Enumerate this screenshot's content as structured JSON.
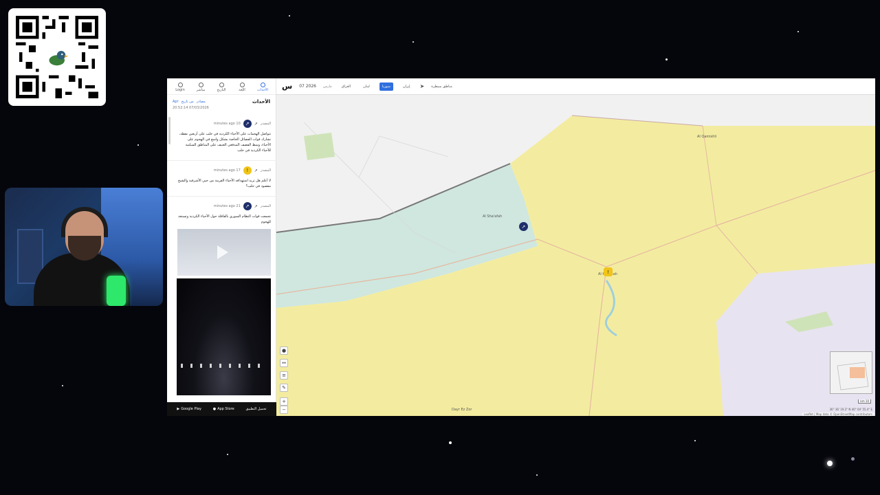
{
  "app": {
    "date": "07 2026",
    "date_label": "مارس",
    "countries": [
      "إيران",
      "سوريا",
      "لبنان",
      "العراق"
    ],
    "active_country": "سوريا",
    "draw_label": "مناطق سيطرة"
  },
  "sidebar": {
    "nav": [
      {
        "label": "Login",
        "icon": "login-icon"
      },
      {
        "label": "مباشر",
        "icon": "clock-icon"
      },
      {
        "label": "التاريخ",
        "icon": "history-icon"
      },
      {
        "label": "اللغة",
        "icon": "globe-icon"
      },
      {
        "label": "الأحداث",
        "icon": "list-icon"
      }
    ],
    "title": "الأحداث",
    "filters": [
      "Apr",
      "من تاريخ",
      "مصادر"
    ],
    "updated": "20:52:14 07/03/2026"
  },
  "posts": [
    {
      "time": "minutes ago 10",
      "source": "المصدر",
      "text": "تتواصل الهجمات على الأحياء الكردية في حلب على أربعين نقطة، تشارك قوات الفصائل الخاصة بشكل واسع في الهجوم على الأحياء، وسط القصف المدفعي العنيف على المناطق السكنية للأحياء الكردية في حلب"
    },
    {
      "time": "minutes ago 17",
      "source": "المصدر",
      "text": "لا أعلم هل تريد استهدافه الأحياء القريبة من حيي الأشرفية والشيخ مقصود في حلب؟"
    },
    {
      "time": "minutes ago 21",
      "source": "المصدر",
      "text": "تجمعت قوات النظام السوري بالقافلة حول الأحياء الكردية وتستعد للهجوم"
    }
  ],
  "store": {
    "google": "Google Play",
    "apple": "App Store",
    "download": "تحميل التطبيق"
  },
  "map": {
    "attribution": "Leaflet | Map data © OpenStreetMap contributors",
    "scale": "km 10",
    "coords": "36° 36' 19.2\" N 40° 04' 55.4\" E",
    "labels": [
      "Al Qamishli",
      "Al Hasakah",
      "Al Sha'afah",
      "Dayr Ez Zor"
    ],
    "colors": {
      "yellow": "#f3eca0",
      "teal": "#cfe7df",
      "lavender": "#e7e3f0",
      "land": "#ececec"
    }
  }
}
